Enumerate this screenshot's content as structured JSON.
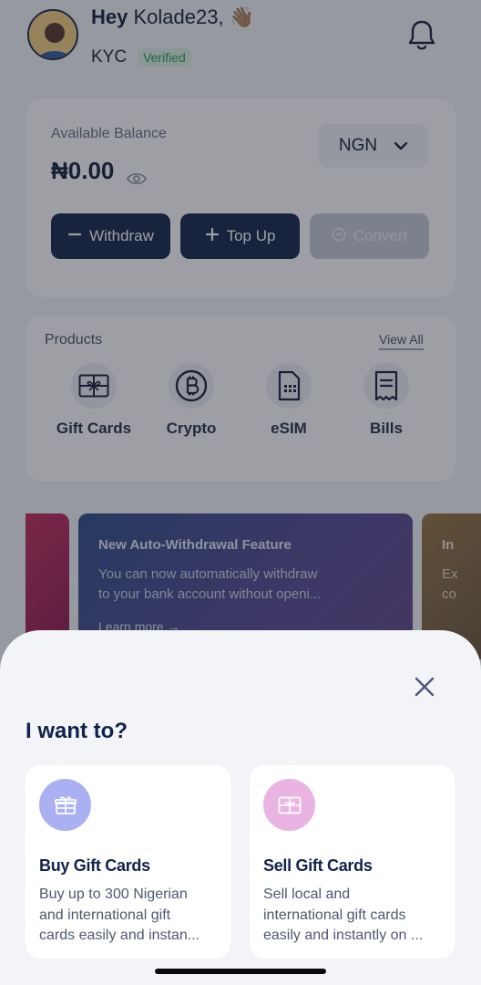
{
  "header": {
    "greeting_hey": "Hey",
    "greeting_name": "Kolade23,",
    "greeting_emoji": "👋🏽",
    "kyc_label": "KYC",
    "kyc_status": "Verified"
  },
  "balance": {
    "label": "Available Balance",
    "amount": "₦0.00",
    "currency": "NGN",
    "withdraw_label": "Withdraw",
    "topup_label": "Top Up",
    "convert_label": "Convert"
  },
  "products": {
    "title": "Products",
    "view_all": "View All",
    "items": [
      {
        "label": "Gift Cards",
        "icon": "gift-card-icon"
      },
      {
        "label": "Crypto",
        "icon": "bitcoin-icon"
      },
      {
        "label": "eSIM",
        "icon": "sim-card-icon"
      },
      {
        "label": "Bills",
        "icon": "receipt-icon"
      }
    ]
  },
  "banners": {
    "main_title": "New Auto-Withdrawal Feature",
    "main_text_line1": "You can now automatically withdraw",
    "main_text_line2": "to your bank account without openi...",
    "main_link": "Learn more →",
    "right_title": "In",
    "right_text_line1": "Ex",
    "right_text_line2": "co"
  },
  "sheet": {
    "title": "I want to?",
    "options": [
      {
        "title": "Buy Gift Cards",
        "desc_line1": "Buy up to 300 Nigerian",
        "desc_line2": "and international gift",
        "desc_line3": "cards easily and instan...",
        "icon": "gift-box-icon"
      },
      {
        "title": "Sell Gift Cards",
        "desc_line1": "Sell local and",
        "desc_line2": "international gift cards",
        "desc_line3": "easily and instantly on ...",
        "icon": "gift-card-icon"
      }
    ]
  },
  "colors": {
    "primary": "#1b2a4e",
    "verified": "#2e9e5a",
    "buy_icon_bg": "#aab0f1",
    "sell_icon_bg": "#e9b3e2"
  }
}
